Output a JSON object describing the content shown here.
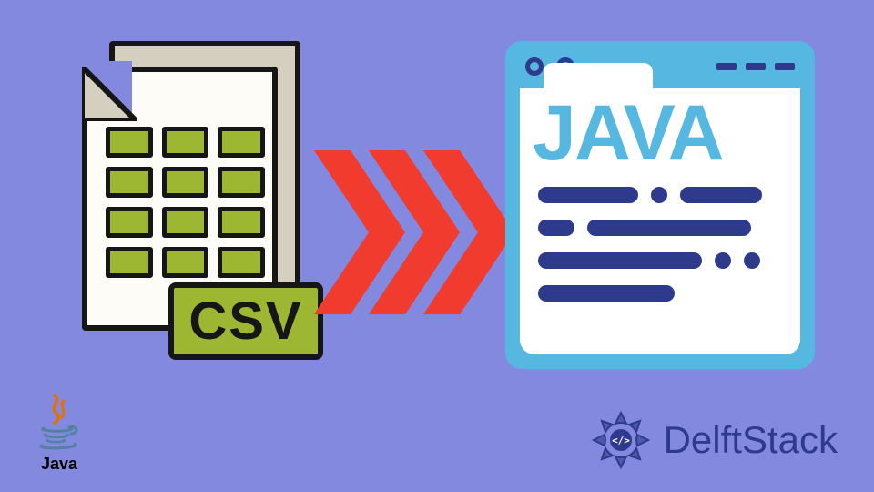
{
  "csv": {
    "badge_label": "CSV",
    "grid_rows": 4,
    "grid_cols": 3
  },
  "arrows": {
    "count": 3,
    "color": "#F03B2E"
  },
  "java_window": {
    "word": "JAVA",
    "titlebar_dots_count": 2,
    "titlebar_dashes_count": 3,
    "code_pattern": [
      [
        "long:120",
        "dot",
        "long:90"
      ],
      [
        "long:40",
        "long:180"
      ],
      [
        "long:220",
        "dot",
        "dot"
      ],
      [
        "long:160"
      ]
    ]
  },
  "logos": {
    "java_label": "Java",
    "delft_label": "DelftStack"
  },
  "colors": {
    "background": "#8289DE",
    "csv_cell": "#9DB733",
    "arrow": "#F03B2E",
    "window_accent": "#56B7E0",
    "window_dark": "#2E3A8C"
  }
}
